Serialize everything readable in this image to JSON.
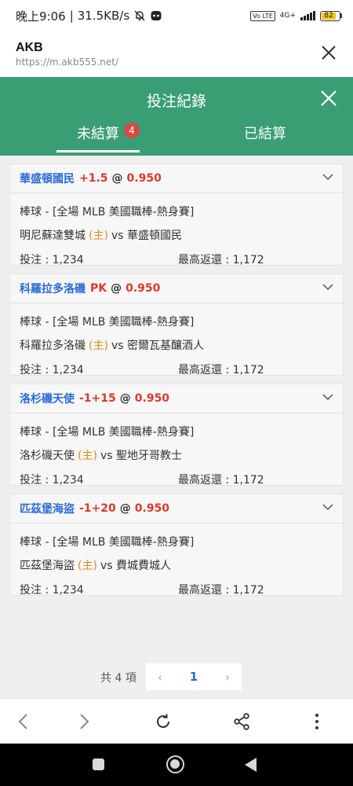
{
  "status_bar": {
    "time": "晚上9:06",
    "speed": "31.5KB/s",
    "network": "4G+",
    "volte": "Vo LTE",
    "battery": "82"
  },
  "browser": {
    "title": "AKB",
    "url": "https://m.akb555.net/"
  },
  "modal": {
    "title": "投注紀錄",
    "tabs": [
      {
        "label": "未結算",
        "badge": "4"
      },
      {
        "label": "已結算"
      }
    ]
  },
  "labels": {
    "stake_prefix": "投注 : ",
    "return_prefix": "最高返還 : ",
    "host_marker": "(主)",
    "vs": "vs",
    "at": "@"
  },
  "bets": [
    {
      "team": "華盛頓國民",
      "handicap": "+1.5",
      "odds": "0.950",
      "league": "棒球 - [全場 MLB 美國職棒-熱身賽]",
      "home": "明尼蘇達雙城",
      "away": "華盛頓國民",
      "stake": "1,234",
      "max_return": "1,172"
    },
    {
      "team": "科羅拉多洛磯",
      "handicap": "PK",
      "odds": "0.950",
      "league": "棒球 - [全場 MLB 美國職棒-熱身賽]",
      "home": "科羅拉多洛磯",
      "away": "密爾瓦基釀酒人",
      "stake": "1,234",
      "max_return": "1,172"
    },
    {
      "team": "洛杉磯天使",
      "handicap": "-1+15",
      "odds": "0.950",
      "league": "棒球 - [全場 MLB 美國職棒-熱身賽]",
      "home": "洛杉磯天使",
      "away": "聖地牙哥教士",
      "stake": "1,234",
      "max_return": "1,172"
    },
    {
      "team": "匹茲堡海盜",
      "handicap": "-1+20",
      "odds": "0.950",
      "league": "棒球 - [全場 MLB 美國職棒-熱身賽]",
      "home": "匹茲堡海盜",
      "away": "費城費城人",
      "stake": "1,234",
      "max_return": "1,172"
    }
  ],
  "pagination": {
    "total": "共 4 項",
    "prev": "‹",
    "current": "1",
    "next": "›"
  },
  "colors": {
    "header_green": "#3a9e75",
    "team_blue": "#2a6ad3",
    "odds_red": "#d93a2b",
    "host_orange": "#e08a1e"
  }
}
